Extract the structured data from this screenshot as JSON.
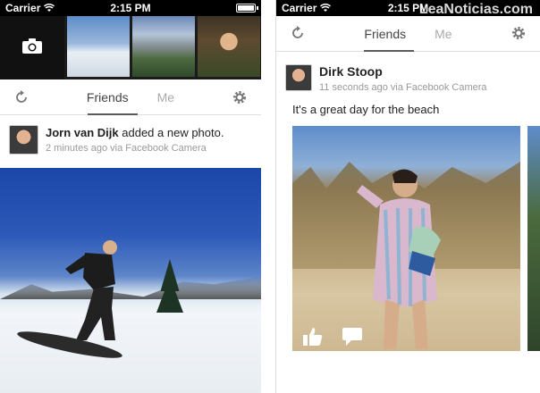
{
  "left": {
    "status": {
      "carrier": "Carrier",
      "time": "2:15 PM",
      "battery_level": 0.9
    },
    "tabs": {
      "friends": "Friends",
      "me": "Me",
      "active": "friends"
    },
    "post": {
      "author": "Jorn van Dijk",
      "action": "added a new photo.",
      "meta": "2 minutes ago via Facebook Camera"
    }
  },
  "right": {
    "status": {
      "carrier": "Carrier",
      "time": "2:15 PM",
      "battery_level": 0.9
    },
    "watermark": "LeaNoticias.com",
    "tabs": {
      "friends": "Friends",
      "me": "Me",
      "active": "friends"
    },
    "post": {
      "author": "Dirk Stoop",
      "meta": "11 seconds ago via Facebook Camera",
      "caption": "It's a great day for the beach"
    }
  },
  "icons": {
    "camera": "camera-icon",
    "refresh": "refresh-icon",
    "settings": "gear-icon",
    "like": "thumbs-up-icon",
    "comment": "comment-icon"
  }
}
